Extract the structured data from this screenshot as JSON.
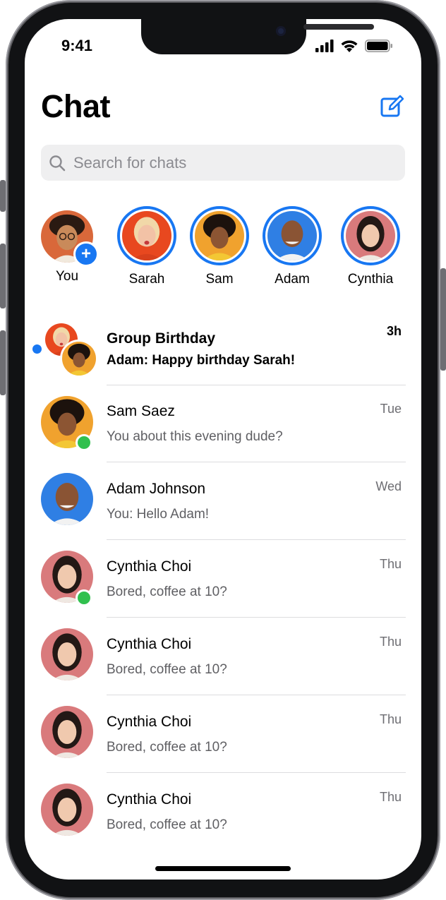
{
  "status_bar": {
    "time": "9:41"
  },
  "header": {
    "title": "Chat"
  },
  "search": {
    "placeholder": "Search for chats",
    "value": ""
  },
  "stories": [
    {
      "label": "You",
      "has_add_badge": true
    },
    {
      "label": "Sarah"
    },
    {
      "label": "Sam"
    },
    {
      "label": "Adam"
    },
    {
      "label": "Cynthia"
    }
  ],
  "chats": [
    {
      "name": "Group Birthday",
      "message": "Adam: Happy birthday Sarah!",
      "time": "3h",
      "unread": true
    },
    {
      "name": "Sam Saez",
      "message": "You about this evening dude?",
      "time": "Tue",
      "online": true
    },
    {
      "name": "Adam Johnson",
      "message": "You: Hello Adam!",
      "time": "Wed"
    },
    {
      "name": "Cynthia Choi",
      "message": "Bored, coffee at 10?",
      "time": "Thu",
      "online": true
    },
    {
      "name": "Cynthia Choi",
      "message": "Bored, coffee at 10?",
      "time": "Thu"
    },
    {
      "name": "Cynthia Choi",
      "message": "Bored, coffee at 10?",
      "time": "Thu"
    },
    {
      "name": "Cynthia Choi",
      "message": "Bored, coffee at 10?",
      "time": "Thu"
    }
  ],
  "colors": {
    "accent": "#1877f2",
    "online": "#31c04e",
    "unread_dot": "#1877f2"
  }
}
